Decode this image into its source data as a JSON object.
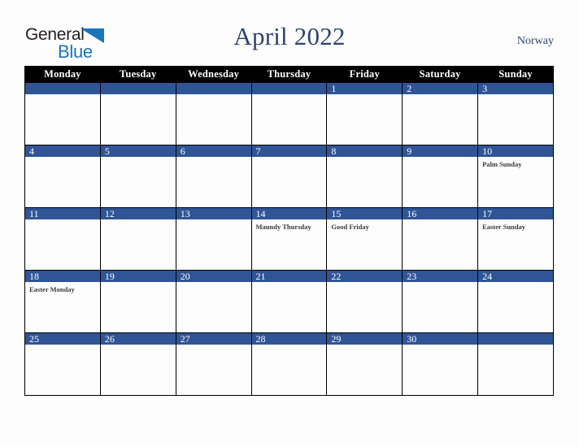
{
  "logo": {
    "text_top": "General",
    "text_bottom": "Blue",
    "triangle": "blue-triangle-icon",
    "accent_color": "#1b75bb"
  },
  "header": {
    "title": "April 2022",
    "country": "Norway",
    "title_color": "#2e4272"
  },
  "theme": {
    "header_row_bg": "#000000",
    "date_band_bg": "#2f5597",
    "date_text": "#ffffff",
    "grid_line": "#000000",
    "page_bg": "#fdfdfd",
    "event_text": "#3a3a3a"
  },
  "weekdays": [
    "Monday",
    "Tuesday",
    "Wednesday",
    "Thursday",
    "Friday",
    "Saturday",
    "Sunday"
  ],
  "weeks": [
    [
      {
        "day": "",
        "events": []
      },
      {
        "day": "",
        "events": []
      },
      {
        "day": "",
        "events": []
      },
      {
        "day": "",
        "events": []
      },
      {
        "day": "1",
        "events": []
      },
      {
        "day": "2",
        "events": []
      },
      {
        "day": "3",
        "events": []
      }
    ],
    [
      {
        "day": "4",
        "events": []
      },
      {
        "day": "5",
        "events": []
      },
      {
        "day": "6",
        "events": []
      },
      {
        "day": "7",
        "events": []
      },
      {
        "day": "8",
        "events": []
      },
      {
        "day": "9",
        "events": []
      },
      {
        "day": "10",
        "events": [
          "Palm Sunday"
        ]
      }
    ],
    [
      {
        "day": "11",
        "events": []
      },
      {
        "day": "12",
        "events": []
      },
      {
        "day": "13",
        "events": []
      },
      {
        "day": "14",
        "events": [
          "Maundy Thursday"
        ]
      },
      {
        "day": "15",
        "events": [
          "Good Friday"
        ]
      },
      {
        "day": "16",
        "events": []
      },
      {
        "day": "17",
        "events": [
          "Easter Sunday"
        ]
      }
    ],
    [
      {
        "day": "18",
        "events": [
          "Easter Monday"
        ]
      },
      {
        "day": "19",
        "events": []
      },
      {
        "day": "20",
        "events": []
      },
      {
        "day": "21",
        "events": []
      },
      {
        "day": "22",
        "events": []
      },
      {
        "day": "23",
        "events": []
      },
      {
        "day": "24",
        "events": []
      }
    ],
    [
      {
        "day": "25",
        "events": []
      },
      {
        "day": "26",
        "events": []
      },
      {
        "day": "27",
        "events": []
      },
      {
        "day": "28",
        "events": []
      },
      {
        "day": "29",
        "events": []
      },
      {
        "day": "30",
        "events": []
      },
      {
        "day": "",
        "events": []
      }
    ]
  ]
}
